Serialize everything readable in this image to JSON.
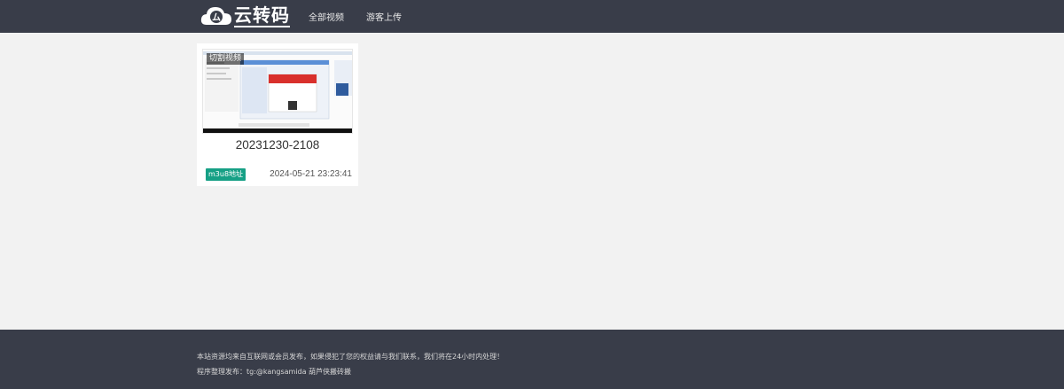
{
  "header": {
    "logo_text": "云转码",
    "nav": [
      {
        "label": "全部视频"
      },
      {
        "label": "游客上传"
      }
    ]
  },
  "videos": [
    {
      "thumbnail_badge": "切割视频",
      "title": "20231230-2108",
      "tag": "m3u8地址",
      "date": "2024-05-21 23:23:41"
    }
  ],
  "footer": {
    "line1": "本站资源均来自互联网或会员发布，如果侵犯了您的权益请与我们联系，我们将在24小时内处理！",
    "line2": "程序整理发布：tg:@kangsamida 葫芦侠搬砖搬"
  },
  "colors": {
    "header_bg": "#393d49",
    "page_bg": "#f2f2f2",
    "tag_bg": "#16a085"
  }
}
